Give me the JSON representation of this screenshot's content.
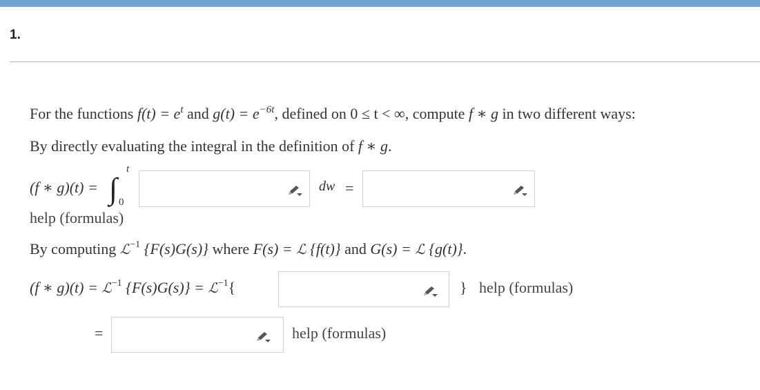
{
  "question": {
    "number": "1."
  },
  "intro": {
    "t1": "For the functions ",
    "f": "f(t) = e",
    "fexp": "t",
    "t2": " and ",
    "g": "g(t) = e",
    "gexp": "−6t",
    "t3": ", defined on ",
    "domain": "0 ≤ t < ∞",
    "t4": ", compute ",
    "fg": "f ∗ g",
    "t5": " in two different ways:"
  },
  "part1": {
    "text": "By directly evaluating the integral in the definition of ",
    "fg": "f ∗ g",
    "dot": ".",
    "lhs": "(f ∗ g)(t) =",
    "upper": "t",
    "lower": "0",
    "dw": "dw",
    "eq": "=",
    "help": "help (formulas)"
  },
  "part2": {
    "t1": "By computing ",
    "Linv": "ℒ",
    "invexp": "−1",
    "expr": " {F(s)G(s)}",
    "t2": " where ",
    "F": "F(s) = ",
    "L": "ℒ",
    "Fexpr": " {f(t)}",
    "t3": " and ",
    "G": "G(s) = ",
    "Gexpr": " {g(t)}",
    "end": "."
  },
  "part2_line": {
    "lhs": "(f ∗ g)(t) = ",
    "mid": " {F(s)G(s)} = ",
    "open": "{",
    "close": "}",
    "help": "help (formulas)"
  },
  "part3": {
    "eq": "=",
    "help": "help (formulas)"
  },
  "colors": {
    "accent_bar": "#6fa3d4",
    "rule": "#9fc2df",
    "box_border": "#cfcfcf"
  },
  "icons": [
    "pencil-icon"
  ]
}
